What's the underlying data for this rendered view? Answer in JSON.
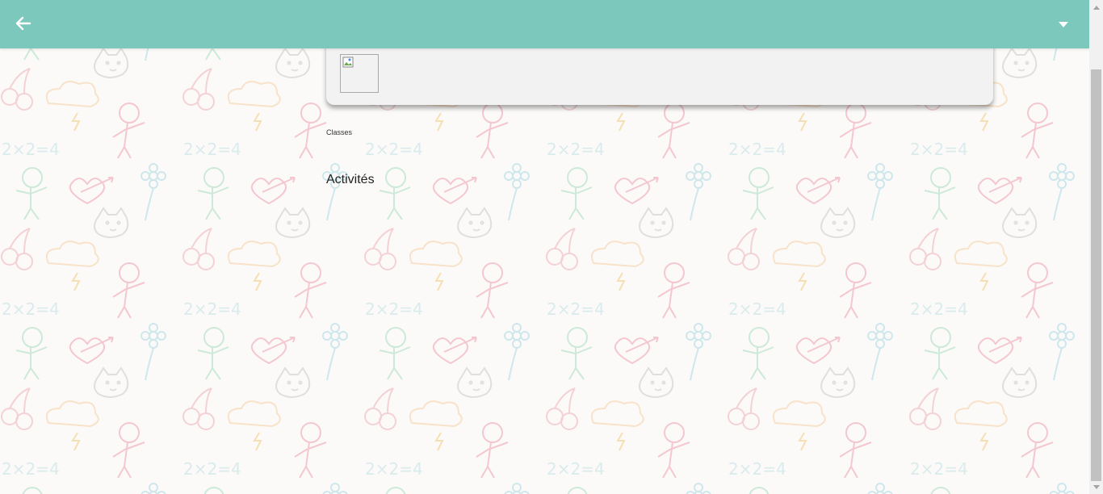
{
  "header": {
    "back_icon": "arrow-left-icon",
    "menu_icon": "caret-down-icon",
    "color": "#7cc8bc"
  },
  "card": {
    "image_icon": "broken-image-icon"
  },
  "content": {
    "classes_label": "Classes",
    "activities_title": "Activités"
  },
  "background": {
    "pattern": "kids-doodle-pattern"
  }
}
